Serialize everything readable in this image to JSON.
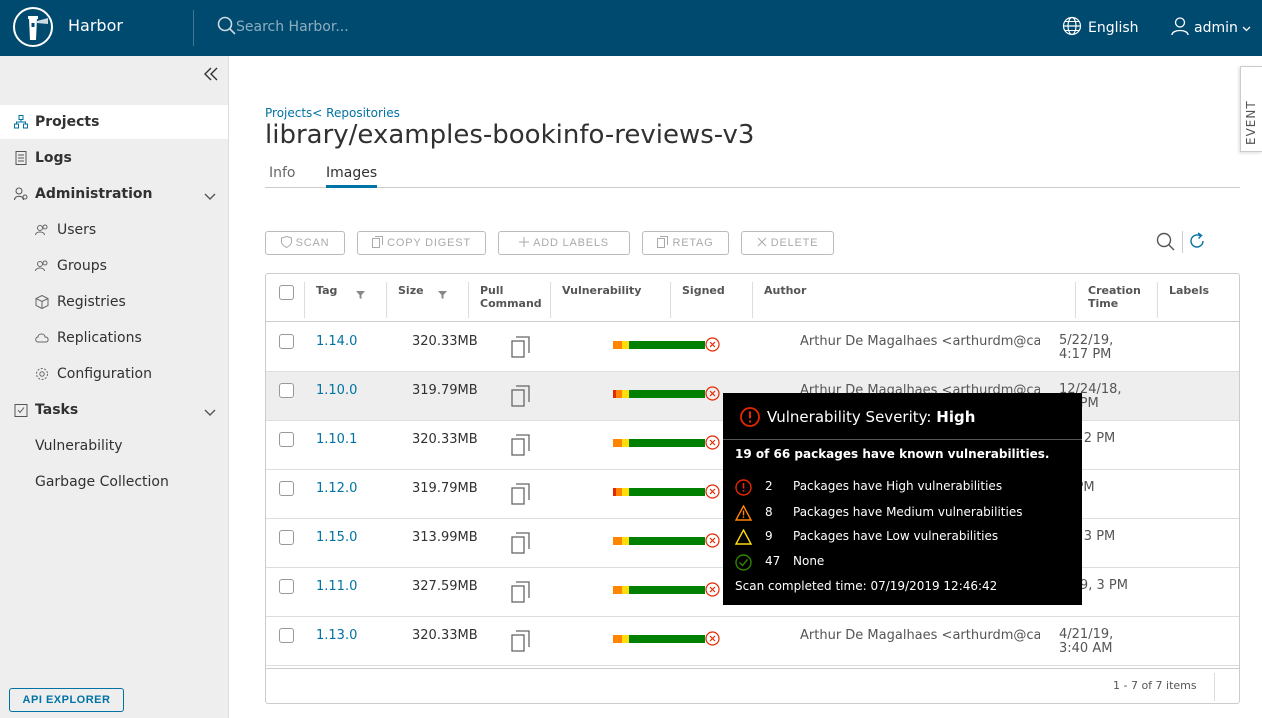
{
  "header": {
    "brand": "Harbor",
    "search_placeholder": "Search Harbor...",
    "language": "English",
    "user": "admin"
  },
  "sidebar": {
    "items": [
      {
        "label": "Projects",
        "icon": "projects-icon",
        "active": true
      },
      {
        "label": "Logs",
        "icon": "logs-icon"
      },
      {
        "label": "Administration",
        "icon": "administration-icon"
      },
      {
        "label": "Users",
        "icon": "users-icon"
      },
      {
        "label": "Groups",
        "icon": "groups-icon"
      },
      {
        "label": "Registries",
        "icon": "registries-icon"
      },
      {
        "label": "Replications",
        "icon": "replications-icon"
      },
      {
        "label": "Configuration",
        "icon": "configuration-icon"
      },
      {
        "label": "Tasks",
        "icon": "tasks-icon"
      },
      {
        "label": "Vulnerability"
      },
      {
        "label": "Garbage Collection"
      }
    ],
    "api_explorer": "API EXPLORER"
  },
  "event_tab": "EVENT",
  "breadcrumb": "Projects< Repositories",
  "title": "library/examples-bookinfo-reviews-v3",
  "tabs": [
    "Info",
    "Images"
  ],
  "toolbar": {
    "scan": "SCAN",
    "copy_digest": "COPY DIGEST",
    "add_labels": "ADD LABELS",
    "retag": "RETAG",
    "delete": "DELETE"
  },
  "table": {
    "columns": [
      "Tag",
      "Size",
      "Pull Command",
      "Vulnerability",
      "Signed",
      "Author",
      "Creation Time",
      "Labels"
    ],
    "rows": [
      {
        "tag": "1.14.0",
        "size": "320.33MB",
        "author": "Arthur De Magalhaes <arthurdm@ca...",
        "created": "5/22/19, 4:17 PM"
      },
      {
        "tag": "1.10.0",
        "size": "319.79MB",
        "author": "Arthur De Magalhaes <arthurdm@ca...",
        "created": "12/24/18, 12 PM"
      },
      {
        "tag": "1.10.1",
        "size": "320.33MB",
        "author": "",
        "created": "19, 2 PM"
      },
      {
        "tag": "1.12.0",
        "size": "319.79MB",
        "author": "",
        "created": "9, PM"
      },
      {
        "tag": "1.15.0",
        "size": "313.99MB",
        "author": "",
        "created": "19, 3 PM"
      },
      {
        "tag": "1.11.0",
        "size": "327.59MB",
        "author": "",
        "created": "2/19, 3 PM"
      },
      {
        "tag": "1.13.0",
        "size": "320.33MB",
        "author": "Arthur De Magalhaes <arthurdm@ca...",
        "created": "4/21/19, 3:40 AM"
      }
    ],
    "footer": "1 - 7 of 7 items"
  },
  "tooltip": {
    "title_prefix": "Vulnerability Severity:",
    "title_level": "High",
    "summary": "19 of 66 packages have known vulnerabilities.",
    "rows": [
      {
        "count": "2",
        "text": "Packages have High vulnerabilities",
        "icon": "high-severity-icon"
      },
      {
        "count": "8",
        "text": "Packages have Medium vulnerabilities",
        "icon": "medium-severity-icon"
      },
      {
        "count": "9",
        "text": "Packages have Low vulnerabilities",
        "icon": "low-severity-icon"
      },
      {
        "count": "47",
        "text": "None",
        "icon": "none-severity-icon"
      }
    ],
    "scan_time": "Scan completed time: 07/19/2019 12:46:42"
  },
  "colors": {
    "header": "#004a70",
    "link": "#0072a3",
    "bar_red": "#e62700",
    "bar_orange": "#ff8400",
    "bar_yellow": "#ffdc0b",
    "bar_green": "#008000"
  }
}
